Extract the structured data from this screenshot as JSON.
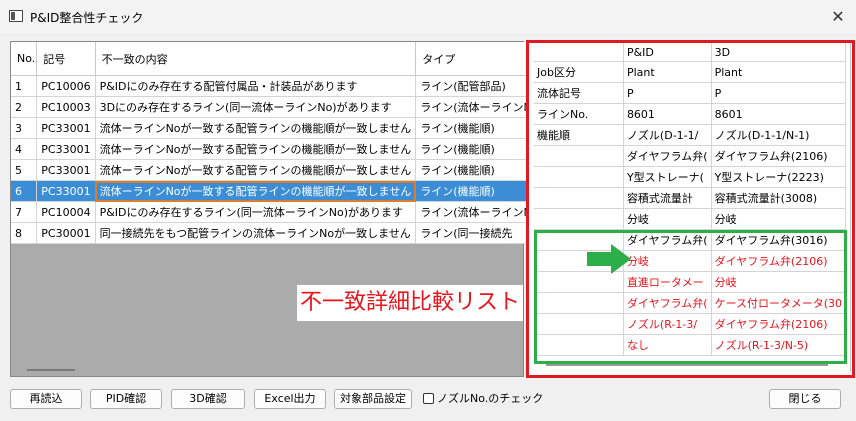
{
  "window": {
    "title": "P&ID整合性チェック"
  },
  "main_table": {
    "columns": [
      "No.",
      "記号",
      "不一致の内容",
      "タイプ"
    ],
    "rows": [
      [
        "1",
        "PC10006",
        "P&IDにのみ存在する配管付属品・計装品があります",
        "ライン(配管部品)"
      ],
      [
        "2",
        "PC10003",
        "3Dにのみ存在するライン(同一流体ーラインNo)があります",
        "ライン(流体ーラインN"
      ],
      [
        "3",
        "PC33001",
        "流体ーラインNoが一致する配管ラインの機能順が一致しません",
        "ライン(機能順)"
      ],
      [
        "4",
        "PC33001",
        "流体ーラインNoが一致する配管ラインの機能順が一致しません",
        "ライン(機能順)"
      ],
      [
        "5",
        "PC33001",
        "流体ーラインNoが一致する配管ラインの機能順が一致しません",
        "ライン(機能順)"
      ],
      [
        "6",
        "PC33001",
        "流体ーラインNoが一致する配管ラインの機能順が一致しません",
        "ライン(機能順)"
      ],
      [
        "7",
        "PC10004",
        "P&IDにのみ存在するライン(同一流体ーラインNo)があります",
        "ライン(流体ーラインN"
      ],
      [
        "8",
        "PC30001",
        "同一接続先をもつ配管ラインの流体ーラインNoが一致しません",
        "ライン(同一接続先"
      ]
    ],
    "selected_index": 5
  },
  "caption": "不一致詳細比較リスト",
  "compare": {
    "header": [
      "",
      "P&ID",
      "3D"
    ],
    "rows": [
      [
        "Job区分",
        "Plant",
        "Plant"
      ],
      [
        "流体記号",
        "P",
        "P"
      ],
      [
        "ラインNo.",
        "8601",
        "8601"
      ],
      [
        "機能順",
        "ノズル(D-1-1/",
        "ノズル(D-1-1/N-1)"
      ],
      [
        "",
        "ダイヤフラム弁(",
        "ダイヤフラム弁(2106)"
      ],
      [
        "",
        "Y型ストレーナ(",
        "Y型ストレーナ(2223)"
      ],
      [
        "",
        "容積式流量計",
        "容積式流量計(3008)"
      ],
      [
        "",
        "分岐",
        "分岐"
      ],
      [
        "",
        "ダイヤフラム弁(",
        "ダイヤフラム弁(3016)"
      ],
      [
        "",
        "分岐",
        "ダイヤフラム弁(2106)"
      ],
      [
        "",
        "直進ロータメー",
        "分岐"
      ],
      [
        "",
        "ダイヤフラム弁(",
        "ケース付ロータメータ(30"
      ],
      [
        "",
        "ノズル(R-1-3/",
        "ダイヤフラム弁(2106)"
      ],
      [
        "",
        "なし",
        "ノズル(R-1-3/N-5)"
      ]
    ],
    "red_from_row": 9
  },
  "buttons": {
    "reload": "再読込",
    "pid_check": "PID確認",
    "check_3d": "3D確認",
    "excel": "Excel出力",
    "target_parts": "対象部品設定",
    "close": "閉じる"
  },
  "nozzle_check": {
    "label": "ノズルNo.のチェック",
    "checked": false
  },
  "colors": {
    "selected_row": "#3b8ed6",
    "focus_outline": "#e07b2a",
    "red_frame": "#e01a22",
    "green_frame": "#2cae48",
    "mismatch_text": "#e8141c"
  }
}
